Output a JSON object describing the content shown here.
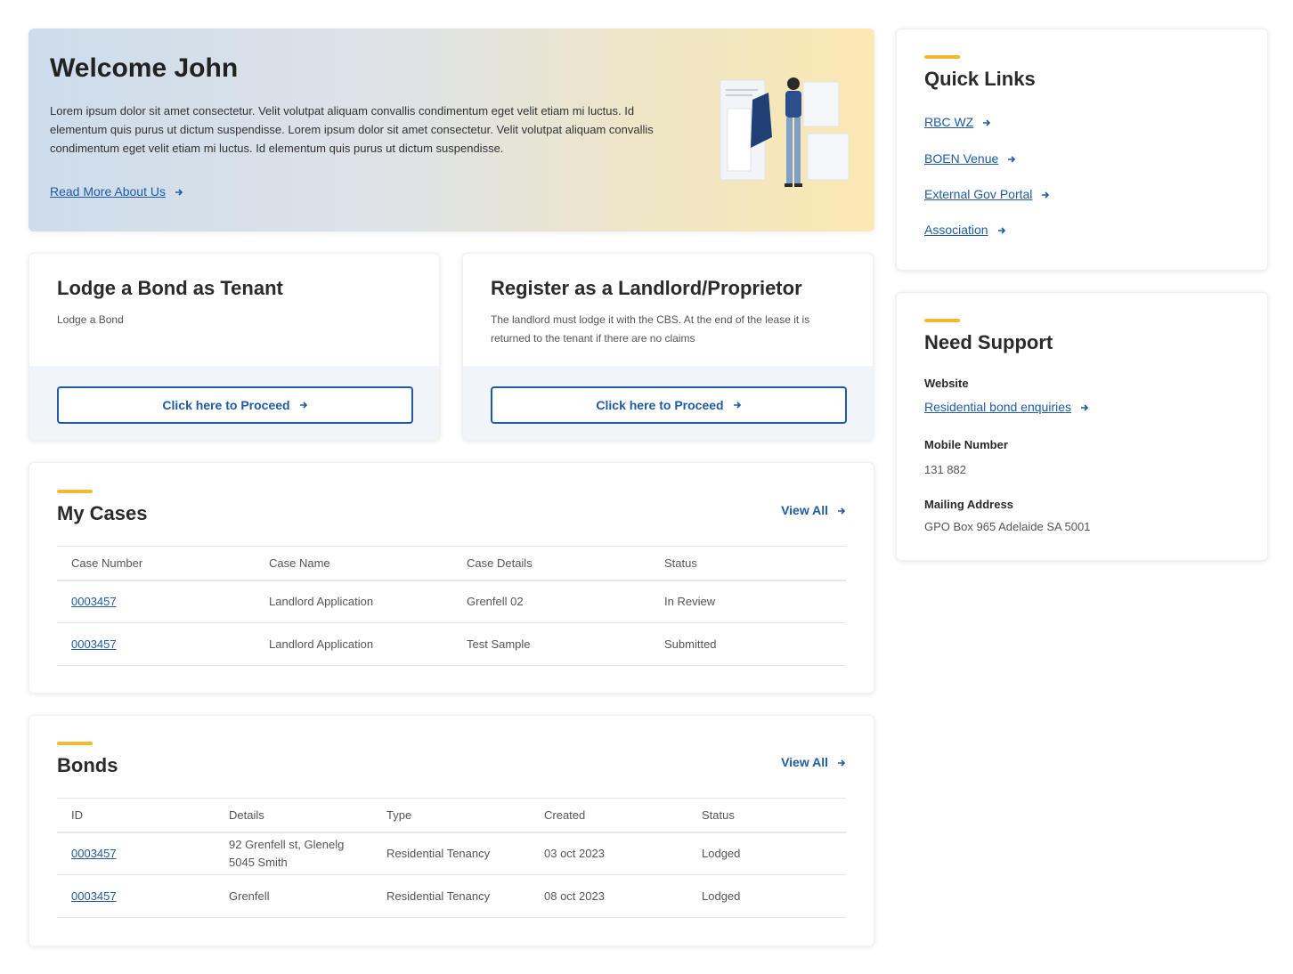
{
  "hero": {
    "title": "Welcome John",
    "body": "Lorem ipsum dolor sit amet consectetur. Velit volutpat aliquam convallis condimentum eget velit etiam mi luctus. Id elementum quis purus ut dictum suspendisse. Lorem ipsum dolor sit amet consectetur. Velit volutpat aliquam convallis condimentum eget velit etiam mi luctus. Id elementum quis purus ut dictum suspendisse.",
    "link": "Read More About Us"
  },
  "cards": [
    {
      "title": "Lodge a Bond as Tenant",
      "desc": "Lodge a Bond",
      "button": "Click here to Proceed"
    },
    {
      "title": "Register as a Landlord/Proprietor",
      "desc": "The landlord must lodge it with the CBS. At the end of the lease it is returned to the tenant if there are no claims",
      "button": "Click here to Proceed"
    }
  ],
  "cases": {
    "title": "My Cases",
    "view_all": "View All",
    "columns": [
      "Case Number",
      "Case Name",
      "Case Details",
      "Status"
    ],
    "rows": [
      [
        "0003457",
        "Landlord Application",
        "Grenfell 02",
        "In Review"
      ],
      [
        "0003457",
        "Landlord Application",
        "Test Sample",
        "Submitted"
      ]
    ]
  },
  "bonds": {
    "title": "Bonds",
    "view_all": "View All",
    "columns": [
      "ID",
      "Details",
      "Type",
      "Created",
      "Status"
    ],
    "rows": [
      [
        "0003457",
        "92 Grenfell st, Glenelg 5045 Smith",
        "Residential Tenancy",
        "03 oct 2023",
        "Lodged"
      ],
      [
        "0003457",
        "Grenfell",
        "Residential Tenancy",
        "08 oct 2023",
        "Lodged"
      ]
    ]
  },
  "quick_links": {
    "title": "Quick Links",
    "items": [
      "RBC WZ",
      "BOEN Venue",
      "External Gov Portal",
      "Association"
    ]
  },
  "support": {
    "title": "Need Support",
    "website_label": "Website",
    "website_link": "Residential bond enquiries",
    "mobile_label": "Mobile Number",
    "mobile_value": "131 882",
    "address_label": "Mailing Address",
    "address_value": "GPO Box 965 Adelaide SA 5001"
  },
  "colors": {
    "accent": "#f5b82e",
    "link": "#1f5aa6"
  }
}
